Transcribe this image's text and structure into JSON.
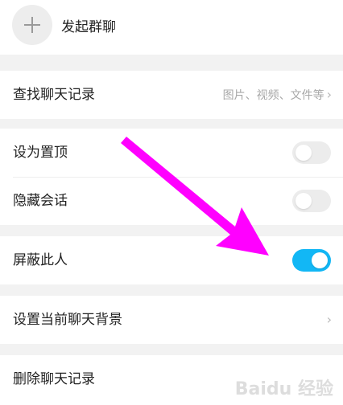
{
  "menu": {
    "start_group": "发起群聊",
    "search_history": {
      "label": "查找聊天记录",
      "hint": "图片、视频、文件等",
      "chevron": "›"
    },
    "pin_top": {
      "label": "设为置顶",
      "enabled": false
    },
    "hide_chat": {
      "label": "隐藏会话",
      "enabled": false
    },
    "block_user": {
      "label": "屏蔽此人",
      "enabled": true
    },
    "chat_background": {
      "label": "设置当前聊天背景",
      "chevron": "›"
    },
    "delete_history": {
      "label": "删除聊天记录"
    }
  },
  "colors": {
    "toggle_on": "#12b7f5",
    "toggle_off": "#ececec",
    "annotation_arrow": "#ff00ff"
  },
  "icons": {
    "add": "plus-icon"
  },
  "watermark": "Baidu 经验"
}
